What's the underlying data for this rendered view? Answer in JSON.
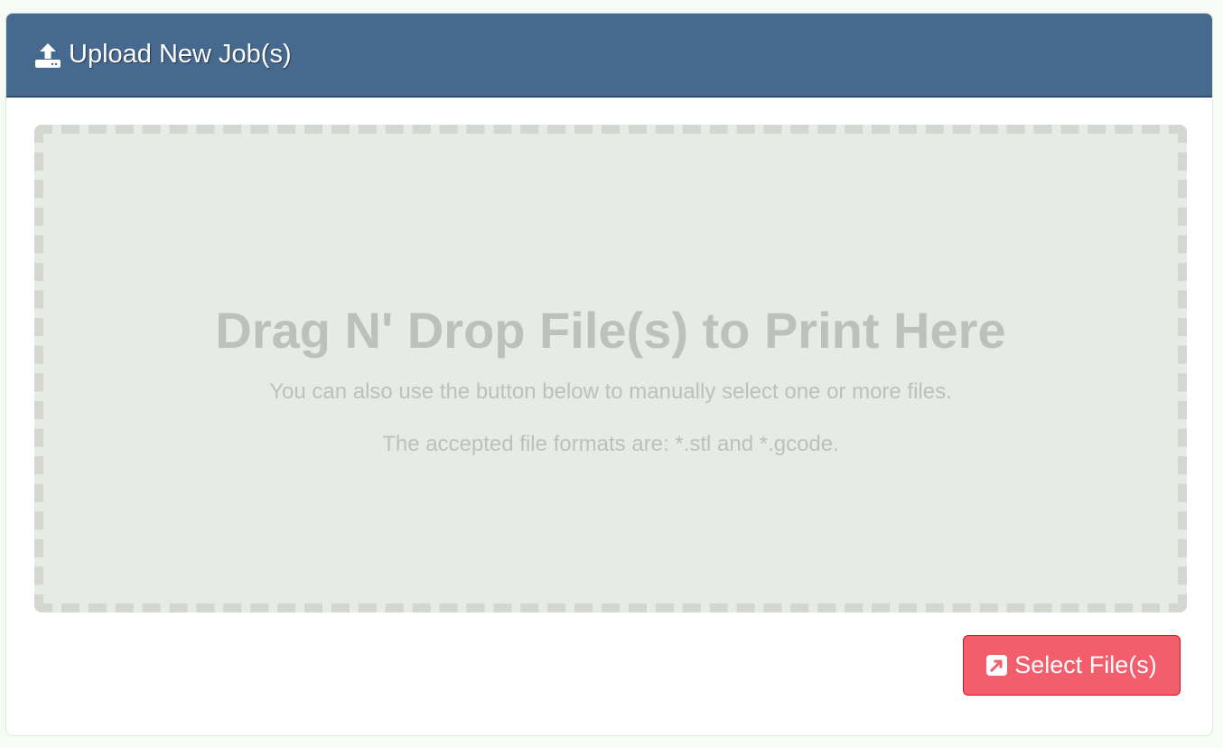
{
  "panel": {
    "title": "Upload New Job(s)",
    "icon": "upload-icon"
  },
  "dropzone": {
    "title": "Drag N' Drop File(s) to Print Here",
    "subtitle": "You can also use the button below to manually select one or more files.",
    "formats": "The accepted file formats are: *.stl and *.gcode."
  },
  "select_button": {
    "label": "Select File(s)",
    "icon": "external-link-icon",
    "color": "#f25e6c"
  }
}
